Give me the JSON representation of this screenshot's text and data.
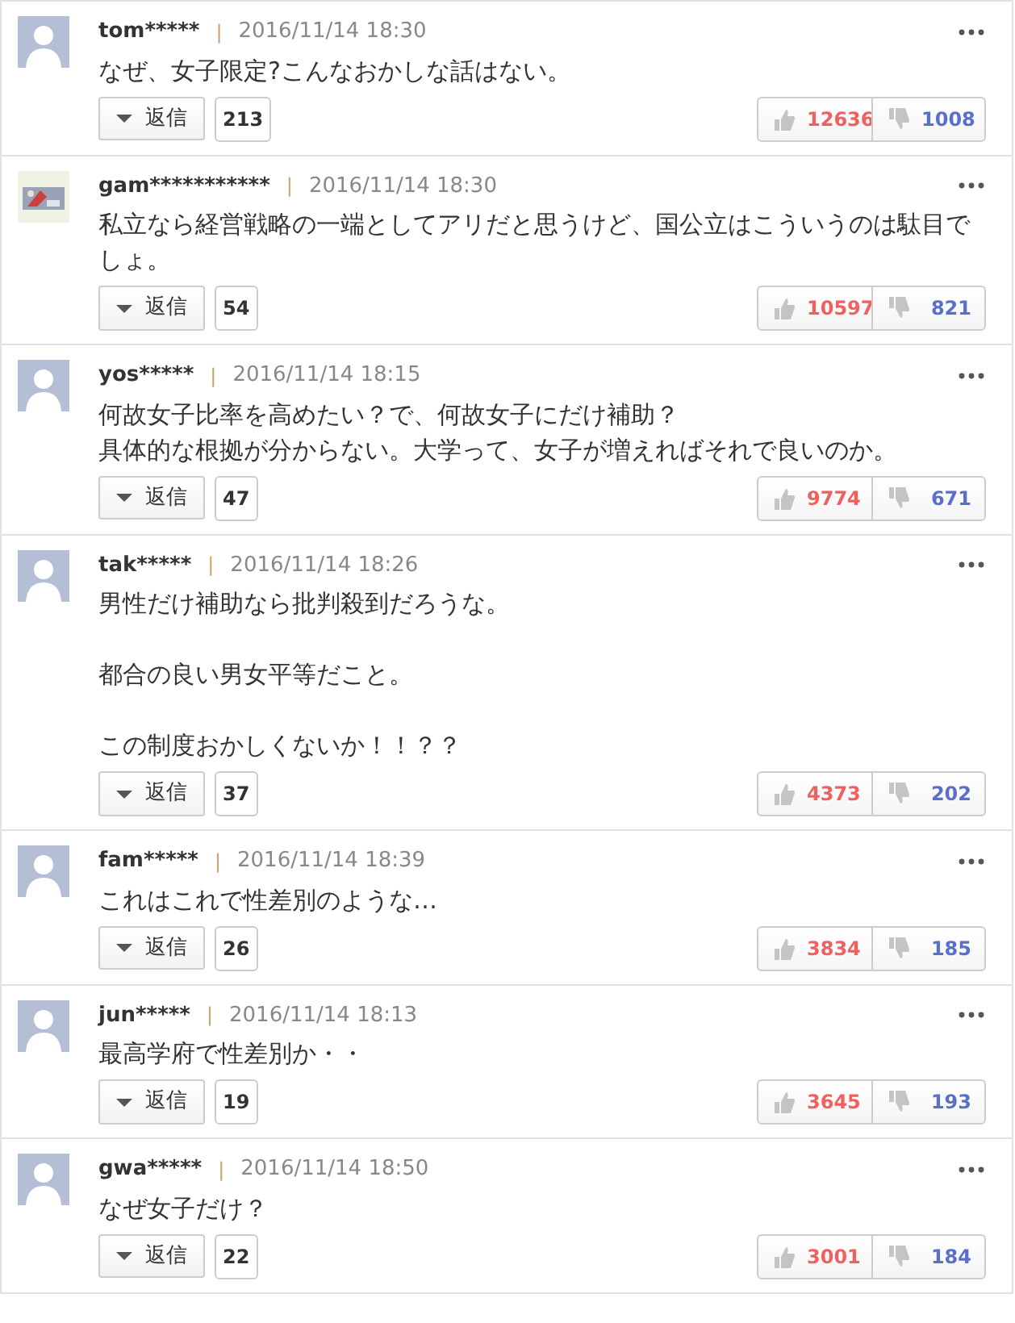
{
  "comments": [
    {
      "user": "tom*****",
      "separator": "|",
      "time": "2016/11/14 18:30",
      "avatar_photo": false,
      "body": [
        [
          "なぜ、女子限定?こんなおかしな話はない。"
        ]
      ],
      "reply_label": "返信",
      "replies": "213",
      "likes": "12636",
      "dislikes": "1008"
    },
    {
      "user": "gam***********",
      "separator": "|",
      "time": "2016/11/14 18:30",
      "avatar_photo": true,
      "body": [
        [
          "私立なら経営戦略の一端としてアリだと思うけど、国公立はこういうのは駄目でしょ。"
        ]
      ],
      "reply_label": "返信",
      "replies": "54",
      "likes": "10597",
      "dislikes": "821"
    },
    {
      "user": "yos*****",
      "separator": "|",
      "time": "2016/11/14 18:15",
      "avatar_photo": false,
      "body": [
        [
          "何故女子比率を高めたい？で、何故女子にだけ補助？",
          "具体的な根拠が分からない。大学って、女子が増えればそれで良いのか。"
        ]
      ],
      "reply_label": "返信",
      "replies": "47",
      "likes": "9774",
      "dislikes": "671"
    },
    {
      "user": "tak*****",
      "separator": "|",
      "time": "2016/11/14 18:26",
      "avatar_photo": false,
      "body": [
        [
          "男性だけ補助なら批判殺到だろうな。"
        ],
        [
          "都合の良い男女平等だこと。"
        ],
        [
          "この制度おかしくないか！！？？"
        ]
      ],
      "reply_label": "返信",
      "replies": "37",
      "likes": "4373",
      "dislikes": "202"
    },
    {
      "user": "fam*****",
      "separator": "|",
      "time": "2016/11/14 18:39",
      "avatar_photo": false,
      "body": [
        [
          "これはこれで性差別のような…"
        ]
      ],
      "reply_label": "返信",
      "replies": "26",
      "likes": "3834",
      "dislikes": "185"
    },
    {
      "user": "jun*****",
      "separator": "|",
      "time": "2016/11/14 18:13",
      "avatar_photo": false,
      "body": [
        [
          "最高学府で性差別か・・"
        ]
      ],
      "reply_label": "返信",
      "replies": "19",
      "likes": "3645",
      "dislikes": "193"
    },
    {
      "user": "gwa*****",
      "separator": "|",
      "time": "2016/11/14 18:50",
      "avatar_photo": false,
      "body": [
        [
          "なぜ女子だけ？"
        ]
      ],
      "reply_label": "返信",
      "replies": "22",
      "likes": "3001",
      "dislikes": "184"
    }
  ]
}
